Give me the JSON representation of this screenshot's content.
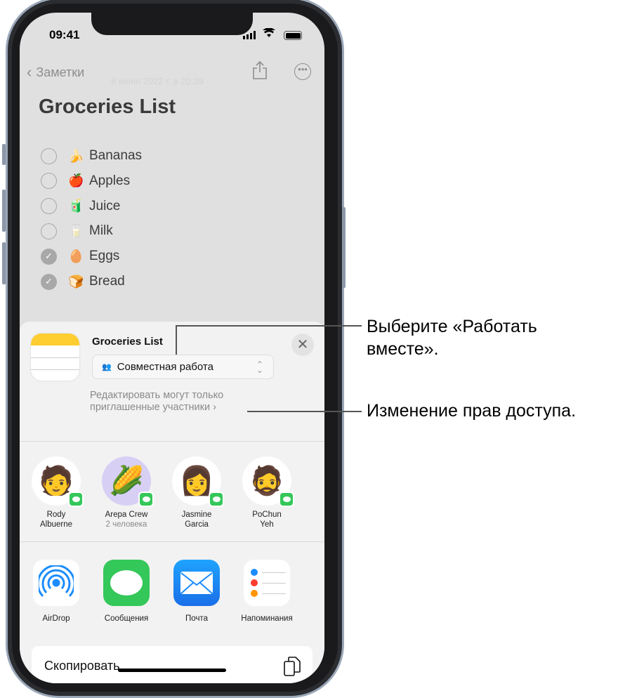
{
  "status_bar": {
    "time": "09:41"
  },
  "nav": {
    "back_label": "Заметки",
    "date": "8 июня 2022 г. в 20:39"
  },
  "note": {
    "title": "Groceries List",
    "items": [
      {
        "emoji": "🍌",
        "label": "Bananas",
        "checked": false
      },
      {
        "emoji": "🍎",
        "label": "Apples",
        "checked": false
      },
      {
        "emoji": "🧃",
        "label": "Juice",
        "checked": false
      },
      {
        "emoji": "🥛",
        "label": "Milk",
        "checked": false
      },
      {
        "emoji": "🥚",
        "label": "Eggs",
        "checked": true
      },
      {
        "emoji": "🍞",
        "label": "Bread",
        "checked": true
      }
    ]
  },
  "share_sheet": {
    "doc_title": "Groceries List",
    "mode_select": "Совместная работа",
    "permissions_line1": "Редактировать могут только",
    "permissions_line2": "приглашенные участники",
    "people": [
      {
        "name1": "Rody",
        "name2": "Albuerne",
        "avatar": "🧑"
      },
      {
        "name1": "Arepa Crew",
        "name2": "2 человека",
        "avatar": "🌽"
      },
      {
        "name1": "Jasmine",
        "name2": "Garcia",
        "avatar": "👩"
      },
      {
        "name1": "PoChun",
        "name2": "Yeh",
        "avatar": "🧔"
      }
    ],
    "apps": [
      "AirDrop",
      "Сообщения",
      "Почта",
      "Напоминания"
    ],
    "copy_label": "Скопировать"
  },
  "callouts": {
    "first_line1": "Выберите «Работать",
    "first_line2": "вместе».",
    "second": "Изменение прав доступа."
  },
  "colors": {
    "messages_green": "#34c759",
    "mail_blue": "#1a8cff",
    "airdrop_blue": "#1a8cff",
    "notes_yellow": "#fecd2f"
  }
}
